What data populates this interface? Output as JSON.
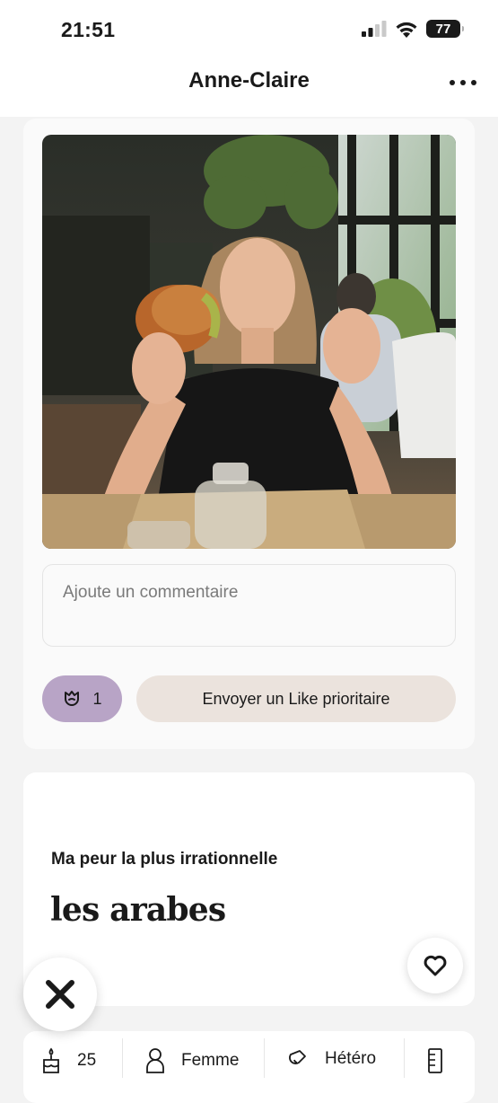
{
  "status_bar": {
    "time": "21:51",
    "battery": "77"
  },
  "header": {
    "title": "Anne-Claire",
    "more_icon": "more-horizontal-icon"
  },
  "photo": {
    "description_icon": "photo"
  },
  "comment": {
    "placeholder": "Ajoute un commentaire"
  },
  "actions": {
    "rose_count": "1",
    "rose_icon": "rose-icon",
    "priority_like_label": "Envoyer un Like prioritaire",
    "rose_color": "#b8a4c6",
    "priority_color": "#ebe3dd"
  },
  "prompt": {
    "question": "Ma peur la plus irrationnelle",
    "answer": "les arabes"
  },
  "info": {
    "age": "25",
    "gender": "Femme",
    "orientation": "Hétéro"
  }
}
